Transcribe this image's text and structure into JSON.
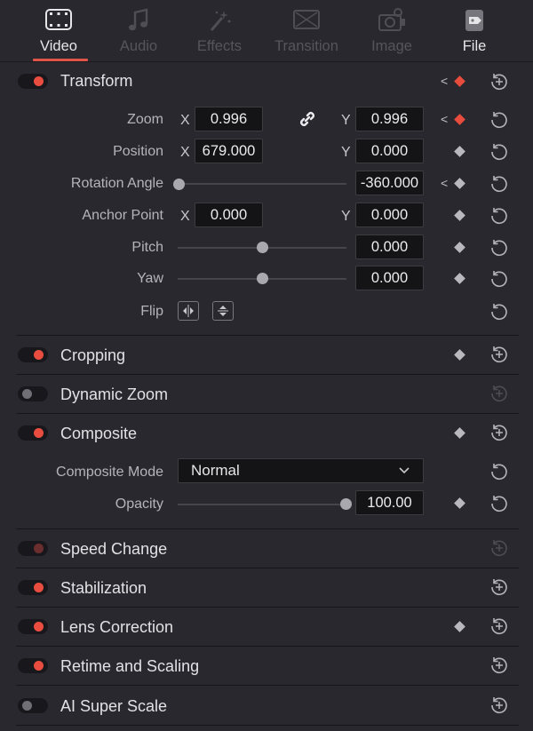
{
  "tabs": [
    {
      "label": "Video",
      "icon": "video-icon",
      "active": true
    },
    {
      "label": "Audio",
      "icon": "music-icon"
    },
    {
      "label": "Effects",
      "icon": "magic-wand-icon"
    },
    {
      "label": "Transition",
      "icon": "transition-icon"
    },
    {
      "label": "Image",
      "icon": "camera-icon"
    },
    {
      "label": "File",
      "icon": "file-tag-icon"
    }
  ],
  "sections": {
    "transform": "Transform",
    "cropping": "Cropping",
    "dynamic_zoom": "Dynamic Zoom",
    "composite": "Composite",
    "speed_change": "Speed Change",
    "stabilization": "Stabilization",
    "lens_correction": "Lens Correction",
    "retime_scaling": "Retime and Scaling",
    "ai_super_scale": "AI Super Scale"
  },
  "transform": {
    "zoom": {
      "label": "Zoom",
      "x": "0.996",
      "y": "0.996"
    },
    "position": {
      "label": "Position",
      "x": "679.000",
      "y": "0.000"
    },
    "rotation": {
      "label": "Rotation Angle",
      "value": "-360.000"
    },
    "anchor": {
      "label": "Anchor Point",
      "x": "0.000",
      "y": "0.000"
    },
    "pitch": {
      "label": "Pitch",
      "value": "0.000"
    },
    "yaw": {
      "label": "Yaw",
      "value": "0.000"
    },
    "flip": {
      "label": "Flip"
    },
    "axis_x": "X",
    "axis_y": "Y"
  },
  "composite": {
    "mode_label": "Composite Mode",
    "mode_value": "Normal",
    "opacity_label": "Opacity",
    "opacity_value": "100.00"
  },
  "colors": {
    "accent": "#e94d40",
    "keyframe_active": "#e84c3d"
  }
}
